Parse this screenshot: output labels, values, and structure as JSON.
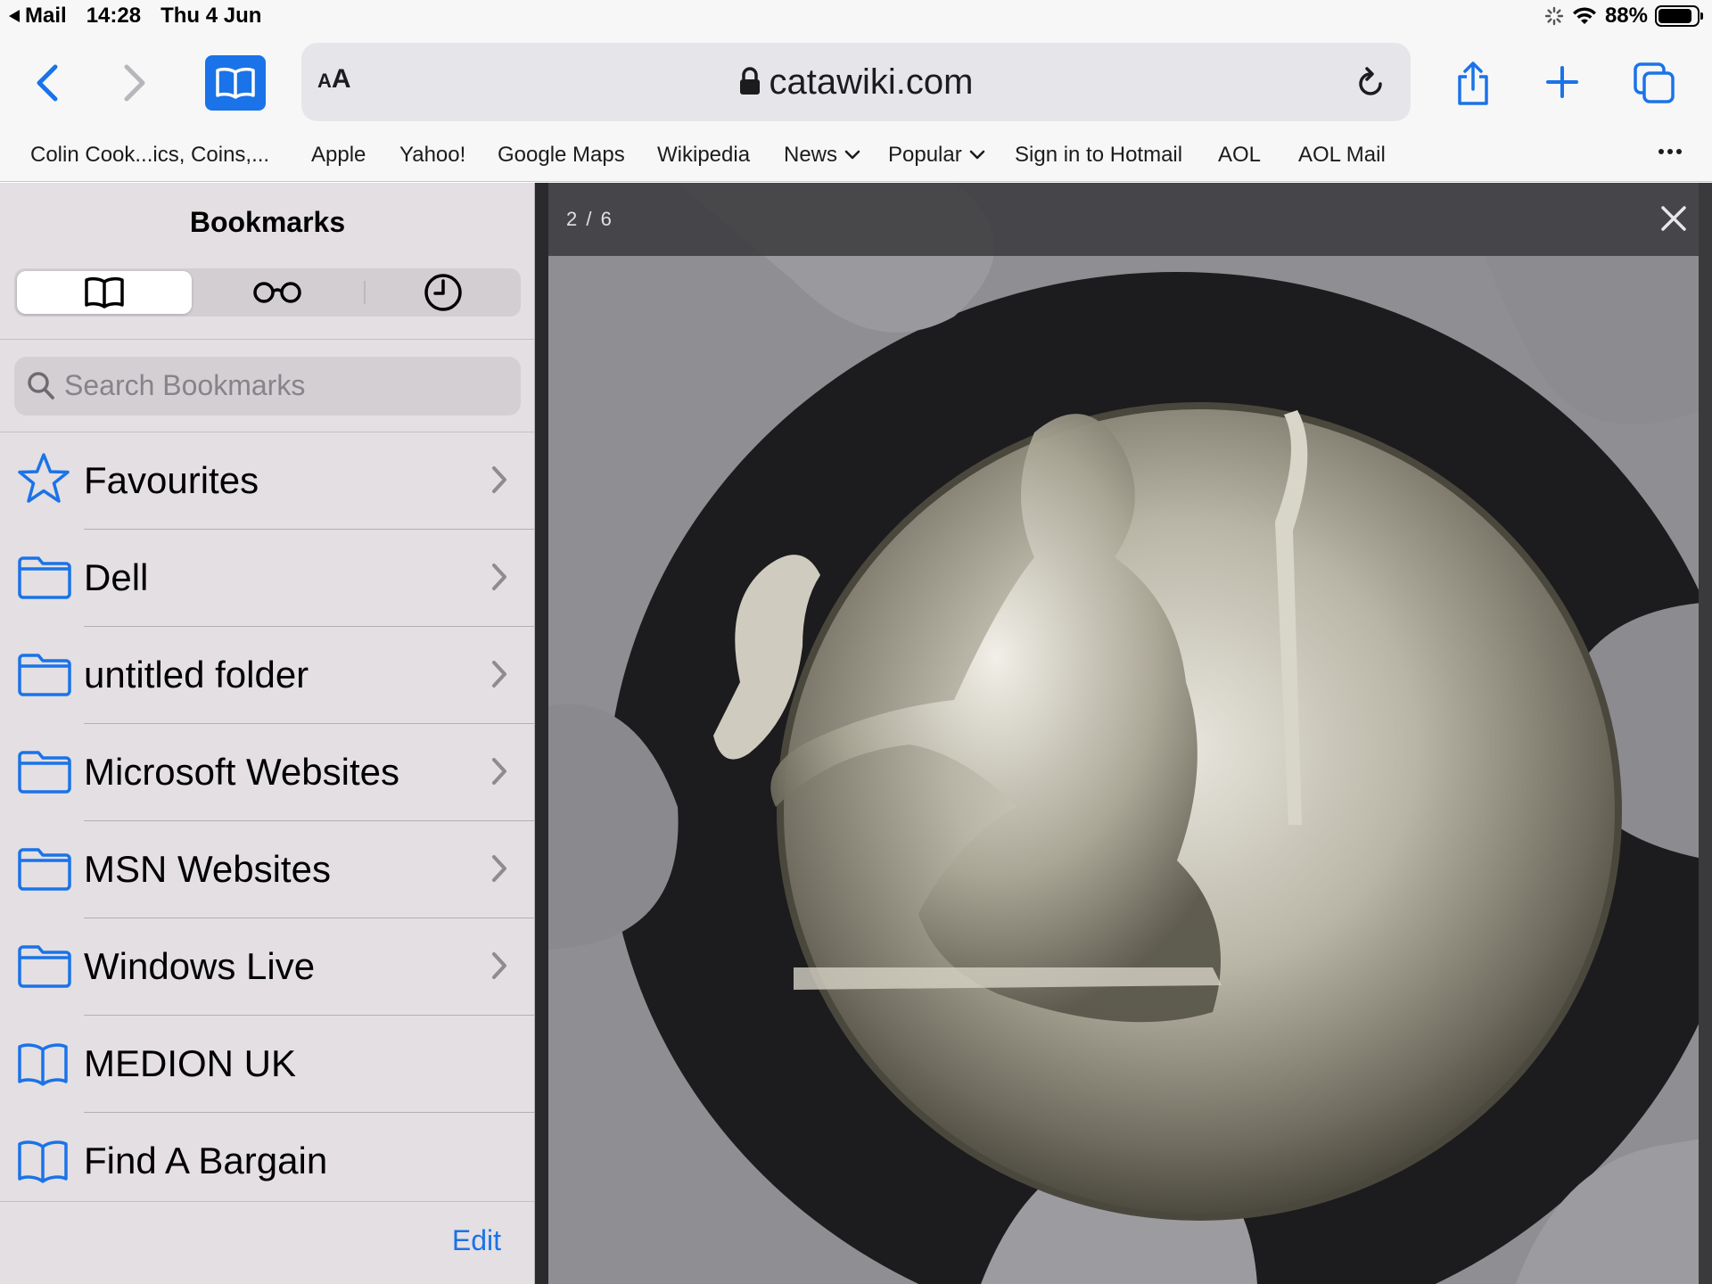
{
  "status_bar": {
    "back_app": "Mail",
    "time": "14:28",
    "date": "Thu 4 Jun",
    "battery": "88%",
    "battery_level": 0.88
  },
  "toolbar": {
    "reader_label": "A",
    "reader_label_small": "A",
    "url": "catawiki.com",
    "icons": [
      "chevron-left-icon",
      "chevron-right-icon",
      "book-icon",
      "lock-icon",
      "reload-icon",
      "share-icon",
      "plus-icon",
      "tabs-icon"
    ]
  },
  "favourites_bar": {
    "items": [
      {
        "label": "Colin Cook...ics, Coins,..."
      },
      {
        "label": "Apple"
      },
      {
        "label": "Yahoo!"
      },
      {
        "label": "Google Maps"
      },
      {
        "label": "Wikipedia"
      },
      {
        "label": "News"
      },
      {
        "label": "Popular"
      },
      {
        "label": "Sign in to Hotmail"
      },
      {
        "label": "AOL"
      },
      {
        "label": "AOL Mail"
      }
    ]
  },
  "sidebar": {
    "title": "Bookmarks",
    "search_placeholder": "Search Bookmarks",
    "items": [
      {
        "label": "Favourites",
        "icon": "star-icon"
      },
      {
        "label": "Dell",
        "icon": "folder-icon"
      },
      {
        "label": "untitled folder",
        "icon": "folder-icon"
      },
      {
        "label": "Microsoft Websites",
        "icon": "folder-icon"
      },
      {
        "label": "MSN Websites",
        "icon": "folder-icon"
      },
      {
        "label": "Windows Live",
        "icon": "folder-icon"
      },
      {
        "label": "MEDION UK",
        "icon": "book-icon"
      },
      {
        "label": "Find A Bargain",
        "icon": "book-icon"
      }
    ],
    "edit_label": "Edit"
  },
  "viewer": {
    "counter": "2 / 6"
  },
  "colors": {
    "accent": "#1a73e8",
    "sidebar_bg": "#e3dfe3",
    "toolbar_bg": "#f7f7f8"
  }
}
